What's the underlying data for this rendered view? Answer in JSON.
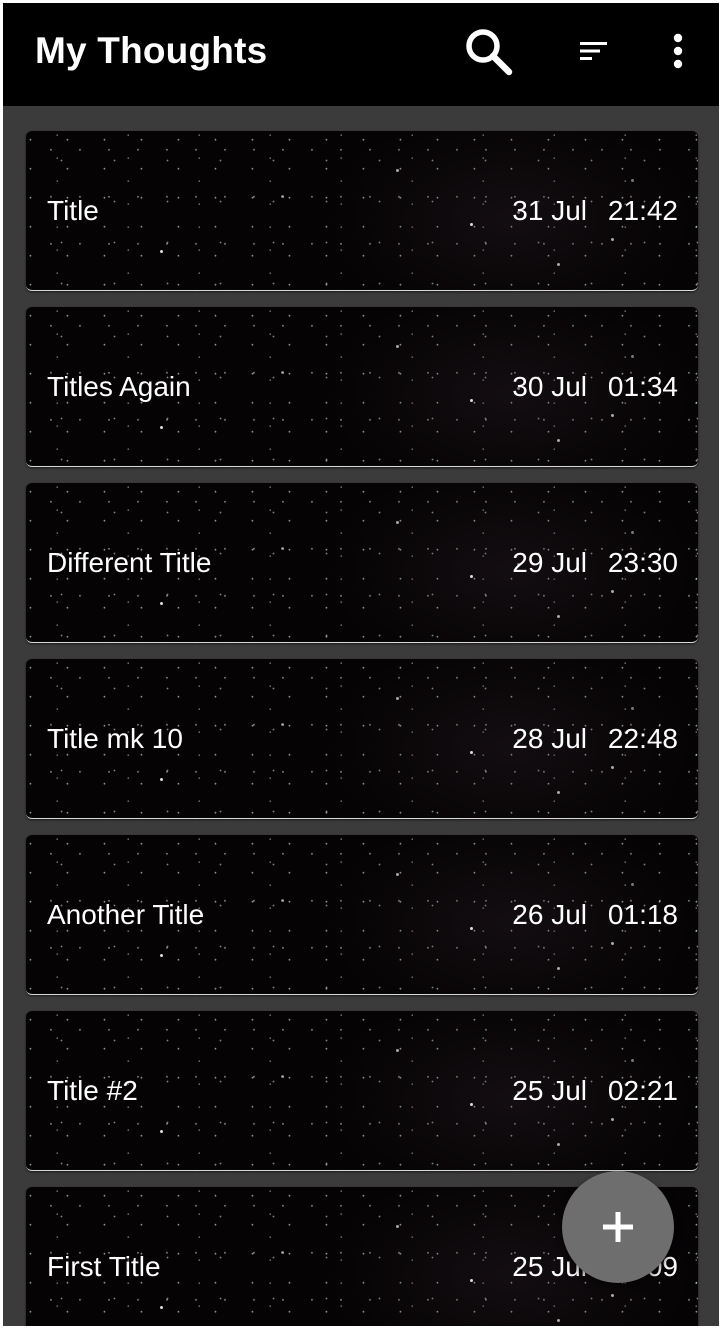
{
  "appbar": {
    "title": "My Thoughts",
    "actions": [
      {
        "name": "search-icon",
        "label": "Search"
      },
      {
        "name": "sort-icon",
        "label": "Sort"
      },
      {
        "name": "more-vert-icon",
        "label": "More options"
      }
    ]
  },
  "notes": [
    {
      "title": "Title",
      "date": "31 Jul",
      "time": "21:42"
    },
    {
      "title": "Titles Again",
      "date": "30 Jul",
      "time": "01:34"
    },
    {
      "title": "Different Title",
      "date": "29 Jul",
      "time": "23:30"
    },
    {
      "title": "Title mk 10",
      "date": "28 Jul",
      "time": "22:48"
    },
    {
      "title": "Another Title",
      "date": "26 Jul",
      "time": "01:18"
    },
    {
      "title": "Title #2",
      "date": "25 Jul",
      "time": "02:21"
    },
    {
      "title": "First Title",
      "date": "25 Jul",
      "time": "02:09"
    }
  ],
  "fab": {
    "icon": "add-icon"
  },
  "colors": {
    "appbar": "#000000",
    "background": "#3b3b3b",
    "card": "#050304",
    "fab": "#6e6e6e",
    "text": "#ffffff"
  }
}
